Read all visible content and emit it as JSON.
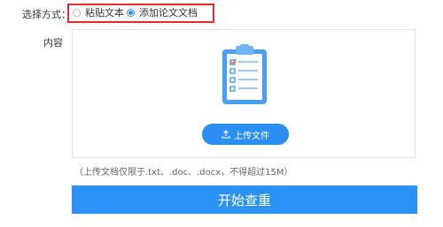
{
  "form": {
    "mode_label": "选择方式：",
    "options": [
      {
        "label": "粘贴文本",
        "selected": false
      },
      {
        "label": "添加论文文档",
        "selected": true
      }
    ],
    "content_label": "内容"
  },
  "upload": {
    "icon": "document-checklist-icon",
    "button_label": "上传文件",
    "hint": "（上传文档仅限于.txt、.doc、.docx，不得超过15M）"
  },
  "actions": {
    "start_label": "开始查重"
  },
  "colors": {
    "accent": "#2b8ef3",
    "highlight_border": "#e32b2b"
  }
}
